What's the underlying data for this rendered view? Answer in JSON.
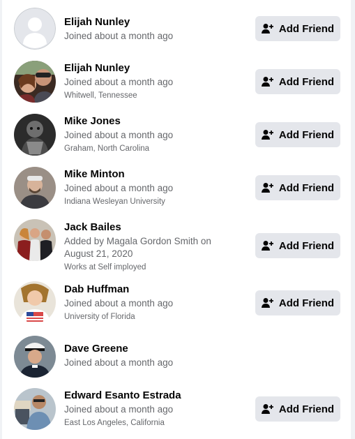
{
  "people": [
    {
      "name": "Elijah Nunley",
      "joined": "Joined about a month ago",
      "detail": "",
      "button": "Add Friend"
    },
    {
      "name": "Elijah Nunley",
      "joined": "Joined about a month ago",
      "detail": "Whitwell, Tennessee",
      "button": "Add Friend"
    },
    {
      "name": "Mike Jones",
      "joined": "Joined about a month ago",
      "detail": "Graham, North Carolina",
      "button": "Add Friend"
    },
    {
      "name": "Mike Minton",
      "joined": "Joined about a month ago",
      "detail": "Indiana Wesleyan University",
      "button": "Add Friend"
    },
    {
      "name": "Jack Bailes",
      "joined": "Added by Magala Gordon Smith on August 21, 2020",
      "detail": "Works at Self imployed",
      "button": "Add Friend"
    },
    {
      "name": "Dab Huffman",
      "joined": "Joined about a month ago",
      "detail": "University of Florida",
      "button": "Add Friend"
    },
    {
      "name": "Dave Greene",
      "joined": "Joined about a month ago",
      "detail": "",
      "button": ""
    },
    {
      "name": "Edward Esanto Estrada",
      "joined": "Joined about a month ago",
      "detail": "East Los Angeles, California",
      "button": "Add Friend"
    }
  ],
  "colors": {
    "button_bg": "#e4e6eb",
    "name_text": "#050505",
    "secondary_text": "#65676b",
    "background": "#f0f2f5"
  },
  "icons": {
    "add_friend": "person-plus-icon",
    "default_avatar": "person-silhouette-icon"
  }
}
